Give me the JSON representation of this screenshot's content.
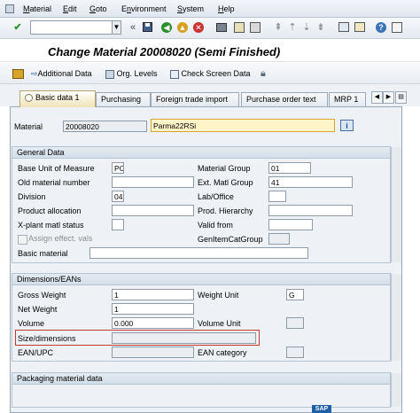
{
  "menu": [
    "Material",
    "Edit",
    "Goto",
    "Environment",
    "System",
    "Help"
  ],
  "menu_underline": [
    "M",
    "E",
    "G",
    "n",
    "S",
    "H"
  ],
  "title": "Change Material 20008020 (Semi Finished)",
  "app_toolbar": {
    "additional_data": "Additional Data",
    "org_levels": "Org. Levels",
    "check_screen_data": "Check Screen Data"
  },
  "tabs": [
    "Basic data 1",
    "Purchasing",
    "Foreign trade import",
    "Purchase order text",
    "MRP 1"
  ],
  "material": {
    "label": "Material",
    "value": "20008020",
    "description": "Parma22RSi"
  },
  "general": {
    "header": "General Data",
    "base_uom_label": "Base Unit of Measure",
    "base_uom": "PC",
    "old_material_label": "Old material number",
    "old_material": "",
    "division_label": "Division",
    "division": "04",
    "product_alloc_label": "Product allocation",
    "xplant_label": "X-plant matl status",
    "assign_effect_label": "Assign effect. vals",
    "basic_material_label": "Basic material",
    "material_group_label": "Material Group",
    "material_group": "01",
    "ext_matl_group_label": "Ext. Matl Group",
    "ext_matl_group": "41",
    "lab_office_label": "Lab/Office",
    "prod_hierarchy_label": "Prod. Hierarchy",
    "valid_from_label": "Valid from",
    "gen_item_cat_label": "GenItemCatGroup"
  },
  "dimensions": {
    "header": "Dimensions/EANs",
    "gross_weight_label": "Gross Weight",
    "gross_weight": "1",
    "net_weight_label": "Net Weight",
    "net_weight": "1",
    "volume_label": "Volume",
    "volume": "0.000",
    "size_label": "Size/dimensions",
    "ean_label": "EAN/UPC",
    "weight_unit_label": "Weight Unit",
    "weight_unit": "G",
    "volume_unit_label": "Volume Unit",
    "ean_category_label": "EAN category"
  },
  "packaging": {
    "header": "Packaging material data"
  },
  "logo": "SAP",
  "colors": {
    "highlight_box": "#c0392b",
    "active_tab": "#f1e3b8",
    "description_field": "#fff4c8"
  },
  "icons": [
    "enter-icon",
    "save-icon",
    "back-icon",
    "exit-icon",
    "cancel-icon",
    "print-icon",
    "find-icon",
    "find-next-icon",
    "first-page-icon",
    "prev-page-icon",
    "next-page-icon",
    "last-page-icon",
    "create-session-icon",
    "shortcut-icon",
    "help-icon",
    "layout-icon"
  ]
}
